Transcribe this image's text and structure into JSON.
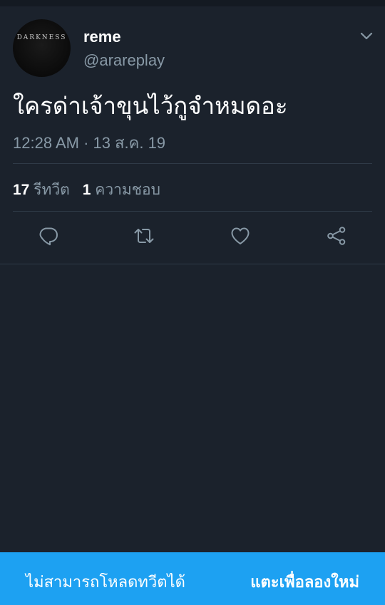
{
  "tweet": {
    "avatar_text": "DARKNESS",
    "display_name": "reme",
    "handle": "@arareplay",
    "text": "ใครด่าเจ้าขุนไว้กูจำหมดอะ",
    "timestamp": "12:28 AM · 13 ส.ค. 19",
    "retweet_count": "17",
    "retweet_label": "รีทวีต",
    "like_count": "1",
    "like_label": "ความชอบ"
  },
  "actions": {
    "reply_icon": "reply-icon",
    "retweet_icon": "retweet-icon",
    "like_icon": "heart-icon",
    "share_icon": "share-icon"
  },
  "bottom_bar": {
    "message": "ไม่สามารถโหลดทวีตได้",
    "retry_label": "แตะเพื่อลองใหม่"
  },
  "colors": {
    "background": "#1b222c",
    "secondary_text": "#8899a6",
    "accent": "#1da1f2"
  }
}
